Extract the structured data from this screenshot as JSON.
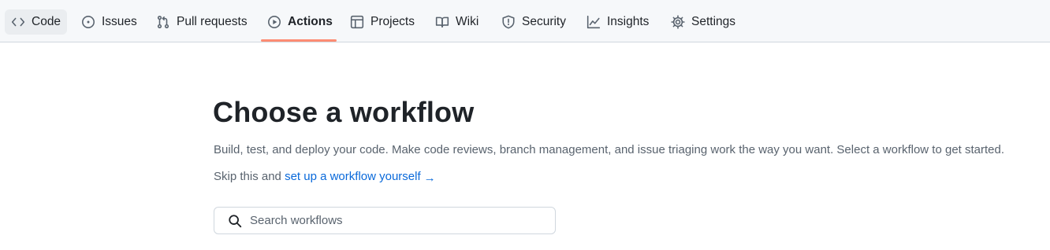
{
  "nav": {
    "tabs": [
      {
        "label": "Code",
        "icon": "code-icon"
      },
      {
        "label": "Issues",
        "icon": "issue-opened-icon"
      },
      {
        "label": "Pull requests",
        "icon": "git-pull-request-icon"
      },
      {
        "label": "Actions",
        "icon": "play-icon",
        "active": true
      },
      {
        "label": "Projects",
        "icon": "table-icon"
      },
      {
        "label": "Wiki",
        "icon": "book-icon"
      },
      {
        "label": "Security",
        "icon": "shield-icon"
      },
      {
        "label": "Insights",
        "icon": "graph-icon"
      },
      {
        "label": "Settings",
        "icon": "gear-icon"
      }
    ],
    "active_underline_color": "#fd8c73"
  },
  "main": {
    "title": "Choose a workflow",
    "description": "Build, test, and deploy your code. Make code reviews, branch management, and issue triaging work the way you want. Select a workflow to get started.",
    "skip_prefix": "Skip this and",
    "skip_link": "set up a workflow yourself",
    "skip_arrow": "→",
    "search": {
      "placeholder": "Search workflows",
      "value": ""
    }
  },
  "colors": {
    "link": "#0969da",
    "text": "#1f2328",
    "muted": "#59636e",
    "border": "#d0d7de",
    "nav_background": "#f6f8fa"
  }
}
